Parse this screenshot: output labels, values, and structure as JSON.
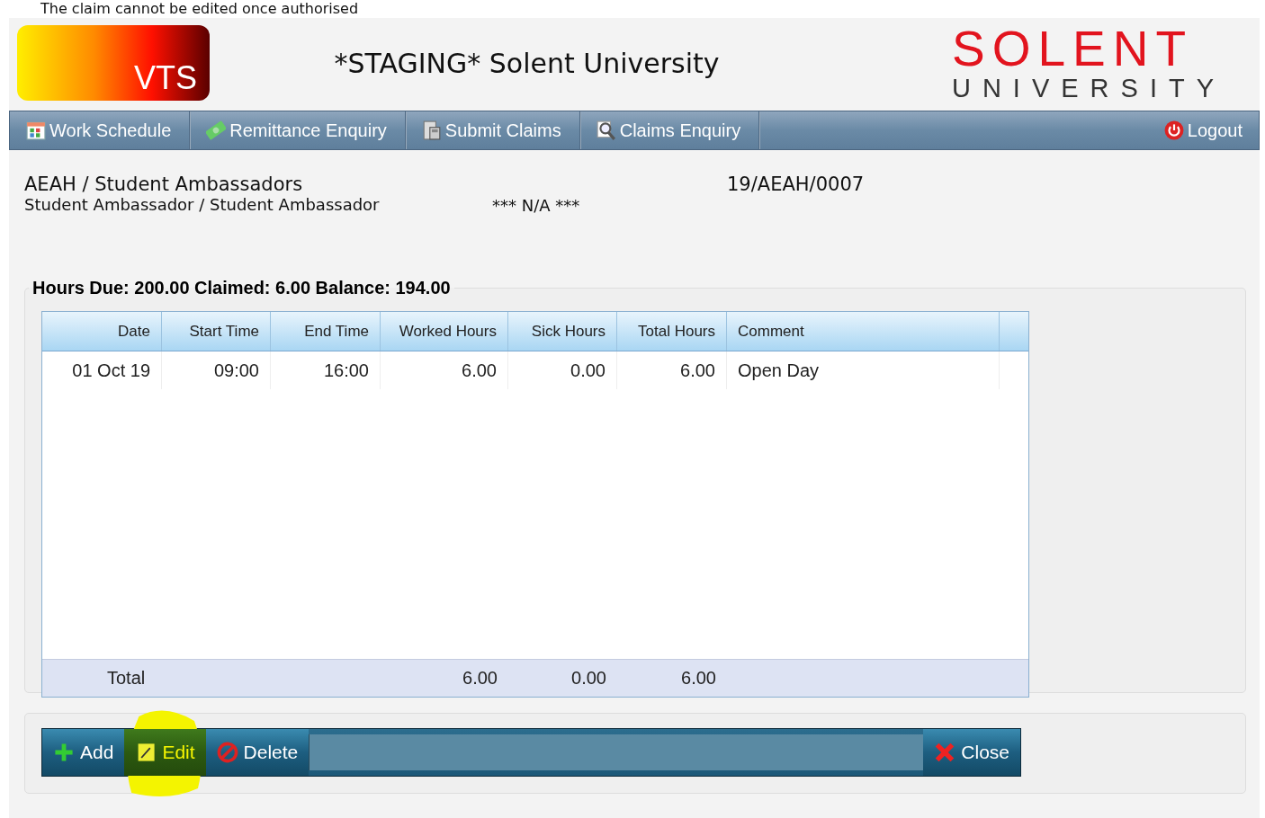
{
  "notice": "The claim cannot be edited once authorised",
  "header": {
    "logo": "VTS",
    "title": "*STAGING* Solent University",
    "brand_name": "SOLENT",
    "brand_sub": "UNIVERSITY"
  },
  "nav": [
    {
      "label": "Work Schedule"
    },
    {
      "label": "Remittance Enquiry"
    },
    {
      "label": "Submit Claims"
    },
    {
      "label": "Claims Enquiry"
    }
  ],
  "logout": "Logout",
  "info": {
    "department": "AEAH / Student Ambassadors",
    "role": "Student Ambassador / Student Ambassador",
    "status": "*** N/A ***",
    "reference": "19/AEAH/0007"
  },
  "summary": "Hours Due: 200.00 Claimed: 6.00 Balance: 194.00",
  "table": {
    "columns": [
      "Date",
      "Start Time",
      "End Time",
      "Worked Hours",
      "Sick Hours",
      "Total Hours",
      "Comment"
    ],
    "rows": [
      [
        "01 Oct 19",
        "09:00",
        "16:00",
        "6.00",
        "0.00",
        "6.00",
        "Open Day"
      ]
    ],
    "total": {
      "label": "Total",
      "worked": "6.00",
      "sick": "0.00",
      "total": "6.00"
    }
  },
  "actions": [
    {
      "label": "Add",
      "highlighted": false
    },
    {
      "label": "Edit",
      "highlighted": true
    },
    {
      "label": "Delete",
      "highlighted": false
    }
  ],
  "close": "Close"
}
